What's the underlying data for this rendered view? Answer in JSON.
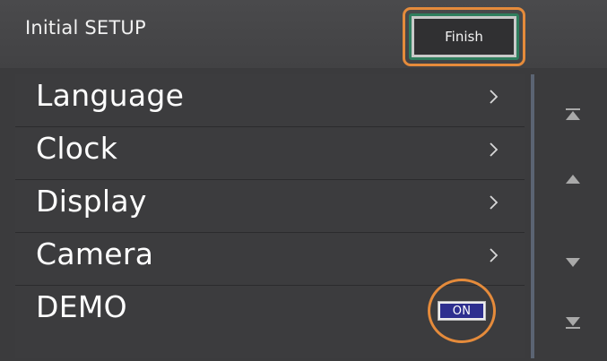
{
  "header": {
    "title": "Initial SETUP",
    "finish_label": "Finish"
  },
  "menu": {
    "items": [
      {
        "label": "Language",
        "icon": "chevron-right-icon"
      },
      {
        "label": "Clock",
        "icon": "chevron-right-icon"
      },
      {
        "label": "Display",
        "icon": "chevron-right-icon"
      },
      {
        "label": "Camera",
        "icon": "chevron-right-icon"
      },
      {
        "label": "DEMO",
        "toggle_label": "ON"
      }
    ]
  },
  "scroll": {
    "icons": [
      "scroll-top-icon",
      "scroll-up-icon",
      "scroll-down-icon",
      "scroll-bottom-icon"
    ]
  },
  "colors": {
    "background": "#3b3b3d",
    "highlight": "#e58b3b",
    "finish_border": "#2f7e5e",
    "toggle_on": "#2e2f8f",
    "scroll_rail": "#5b6473"
  }
}
